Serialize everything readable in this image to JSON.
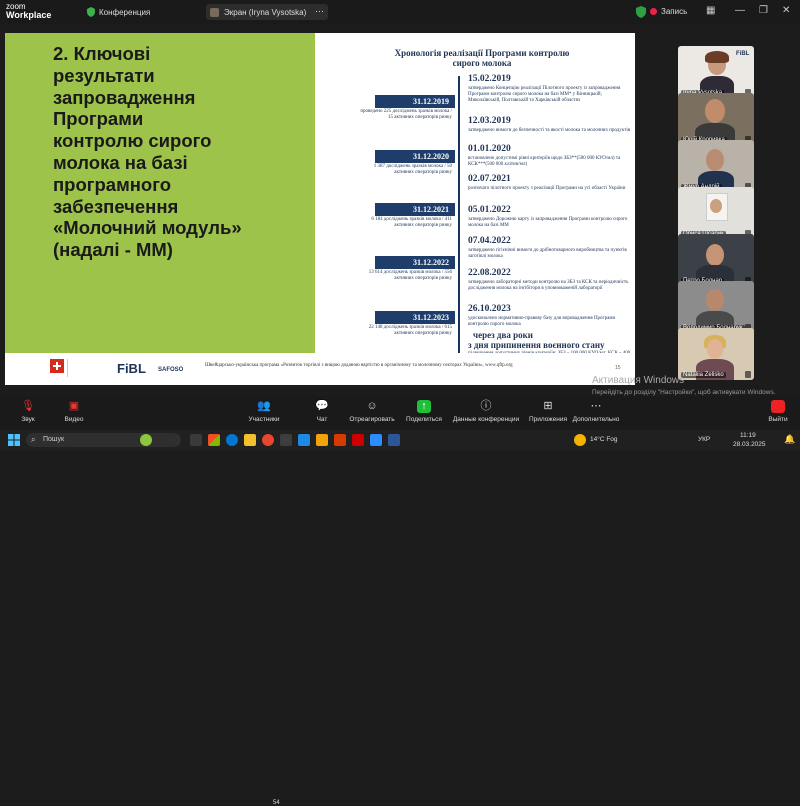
{
  "app": {
    "brand_top": "zoom",
    "brand_bottom": "Workplace",
    "conference_label": "Конференция",
    "share_label": "Экран (Iryna Vysotska)",
    "record_label": "Запись"
  },
  "slide": {
    "title_lines": [
      "2. Ключові",
      "результати",
      "запровадження",
      "Програми",
      "контролю сирого",
      "молока на базі",
      "програмного",
      "забезпечення",
      "«Молочний модуль»",
      "(надалі - ММ)"
    ],
    "timeline_title": "Хронологія реалізації  Програми контролю сирого молока",
    "dates": [
      "15.02.2019",
      "12.03.2019",
      "01.01.2020",
      "02.07.2021",
      "05.01.2022",
      "07.04.2022",
      "22.08.2022",
      "26.10.2023",
      "через два роки",
      "з дня припинення воєнного стану"
    ],
    "desc": [
      "затверджено Концепцію реалізації Пілотного проекту із запровадження Програми контролю сирого молока на базі ММ* у Вінницькій, Миколаївській, Полтавській та Харківській областях",
      "затверджено вимоги до безпечності та якості молока та молочних продуктів",
      "встановлено допустимі рівні критеріїв щодо ЗБЗ**(500 000 КУО/мл) та КСК***(500 000 клітин/мл)",
      "розпочато пілотного проекту з реалізації Програми на усі області України",
      "затверджено Дорожню карту із запровадження Програми контролю сирого молока на базі ММ",
      "затверджено гігієнічні вимоги до дрібнотоварного виробництва та пунктів заготівлі молока",
      "затверджено лабораторні методи контролю на ЗБЗ та КСК та періодичність дослідження молока на інгібітори в уповноваженій лабораторії",
      "удосконалено нормативно-правову базу для впровадження Програми контролю сирого молока",
      "підвищення допустимих рівнів критеріїв: ЗБЗ – 100 000 КУО/мл; КСК – 400 000 клітин/мл"
    ],
    "year_tags": [
      "31.12.2019",
      "31.12.2020",
      "31.12.2021",
      "31.12.2022",
      "31.12.2023"
    ],
    "year_notes": [
      "проведено 225 досліджень зразків молока / 15 активних операторів ринку",
      "1 387 досліджень зразків молока / 50 активних операторів ринку",
      "6 184 досліджень зразків молока / 411 активних операторів ринку",
      "13 614 досліджень зразків молока / 556 активних операторів ринку",
      "22 148 досліджень зразків молока / 615 активних операторів ринку"
    ],
    "footer_text": "Швейцарсько-українська програма «Розвиток торгівлі з вищою доданою вартістю в органічному та молочному секторах України», www.qftp.org",
    "page_number": "15",
    "logos": [
      "FiBL",
      "SAFOSO"
    ]
  },
  "participants": [
    {
      "name": "Iryna Vysotska"
    },
    {
      "name": "Юрій Кропивка"
    },
    {
      "name": "Жмур Андрій"
    },
    {
      "name": "Орися Цісарик"
    },
    {
      "name": "Петро Боднар"
    },
    {
      "name": "Володимир Боднарук"
    },
    {
      "name": "Nataliia Zelisko"
    }
  ],
  "toolbar": {
    "audio": "Звук",
    "video": "Видео",
    "participants": "Участники",
    "participants_count": "54",
    "chat": "Чат",
    "react": "Отреагировать",
    "share": "Поделиться",
    "conf_data": "Данные конференции",
    "apps": "Приложения",
    "more": "Дополнительно",
    "end": "Выйти"
  },
  "watermark": {
    "title": "Активация Windows",
    "sub": "Перейдіть до розділу \"Настройки\", щоб активувати Windows."
  },
  "taskbar": {
    "search_placeholder": "Пошук",
    "weather": "14°C  Fog",
    "lang": "УКР",
    "time": "11:19",
    "date": "28.03.2025"
  },
  "colors": {
    "slide_green": "#9dc34b",
    "navy": "#1f3d6a",
    "record_red": "#e22244"
  }
}
